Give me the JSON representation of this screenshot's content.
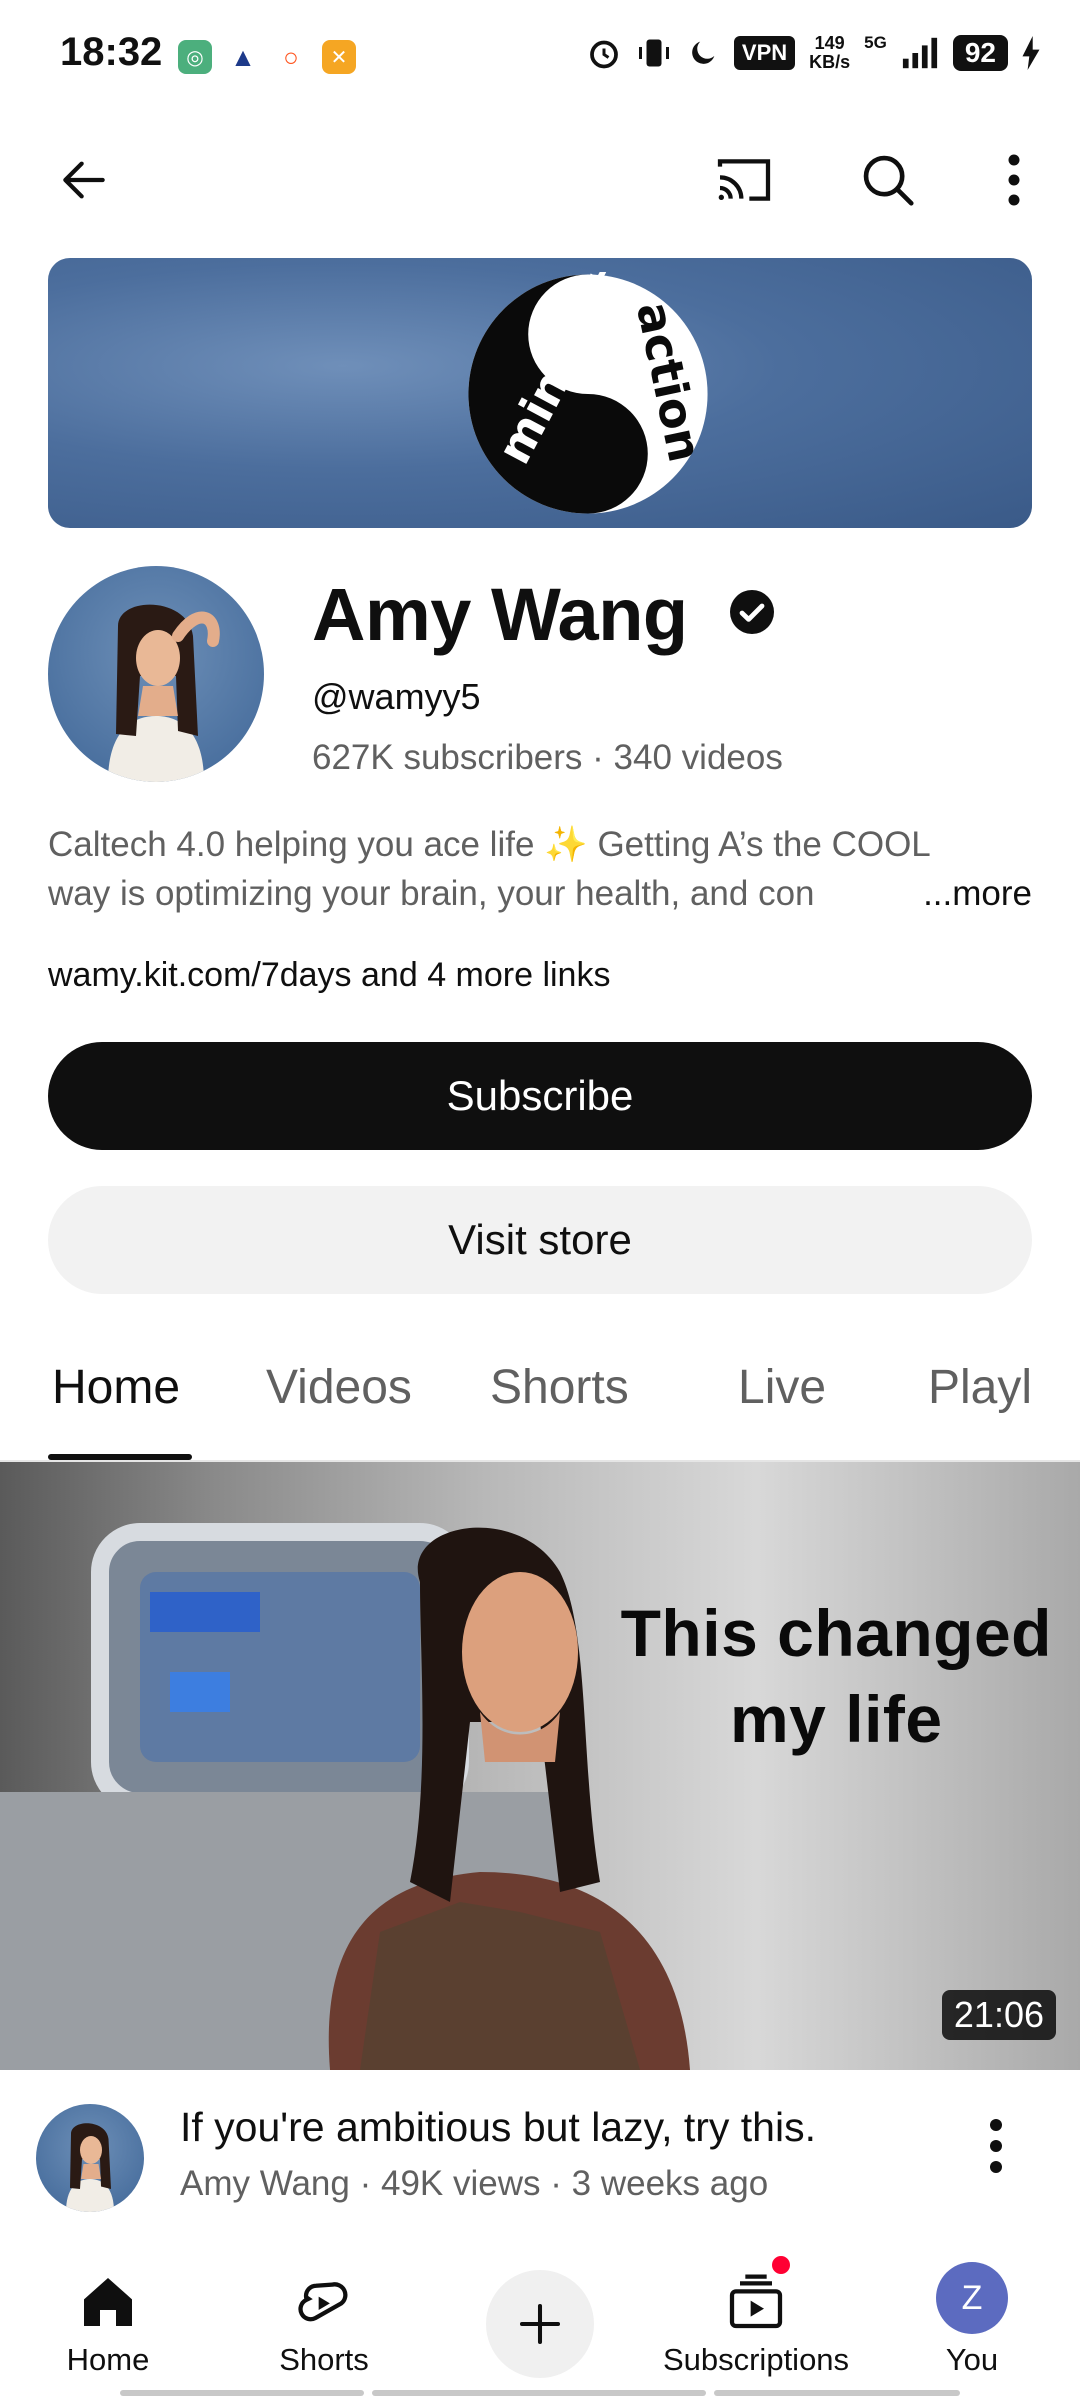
{
  "status_bar": {
    "time": "18:32",
    "vpn": "VPN",
    "speed_value": "149",
    "speed_unit": "KB/s",
    "network": "5G",
    "battery": "92"
  },
  "channel": {
    "name": "Amy Wang",
    "handle": "@wamyy5",
    "subscribers": "627K subscribers",
    "videos": "340 videos",
    "description_line1": "Caltech 4.0 helping you ace life ✨ Getting A’s the COOL",
    "description_line2": "way is optimizing your brain, your health, and con",
    "more": "...more",
    "link": "wamy.kit.com/7days",
    "link_more": "and 4 more links",
    "subscribe_label": "Subscribe",
    "store_label": "Visit store"
  },
  "banner": {
    "logo_text_left": "mindset",
    "logo_text_right": "action"
  },
  "tabs": [
    "Home",
    "Videos",
    "Shorts",
    "Live",
    "Playl"
  ],
  "active_tab": "Home",
  "video": {
    "thumbnail_text_line1": "This changed",
    "thumbnail_text_line2": "my life",
    "duration": "21:06",
    "title": "If you're ambitious but lazy, try this.",
    "author": "Amy Wang",
    "views": "49K views",
    "age": "3 weeks ago"
  },
  "bottom_nav": {
    "home": "Home",
    "shorts": "Shorts",
    "subscriptions": "Subscriptions",
    "you": "You",
    "you_initial": "Z"
  },
  "colors": {
    "primary_text": "#0f0f0f",
    "secondary_text": "#606060",
    "subscribe_bg": "#0f0f0f",
    "notification_dot": "#ff0033",
    "you_avatar": "#5c6bc0"
  }
}
